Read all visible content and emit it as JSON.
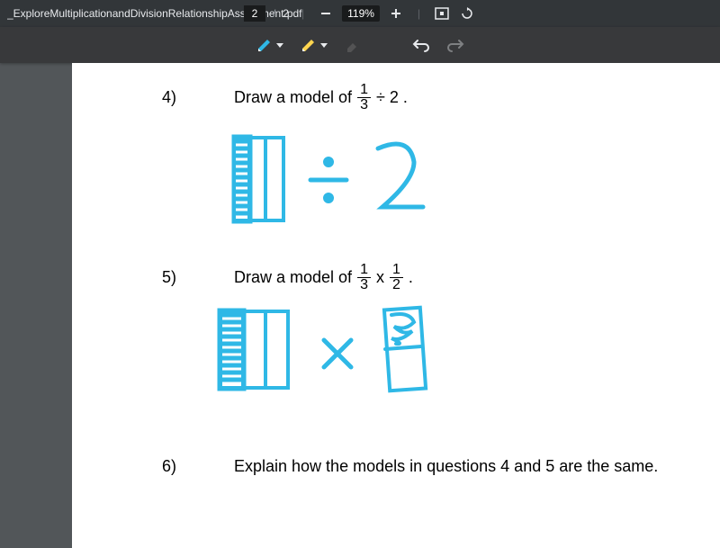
{
  "header": {
    "filename": "_ExploreMultiplicationandDivisionRelationshipAssignment.pdf",
    "current_page": "2",
    "page_separator": "/",
    "total_pages": "2",
    "zoom": "119%"
  },
  "problems": {
    "p4": {
      "number": "4)",
      "prompt_pre": "Draw a model of ",
      "frac_num": "1",
      "frac_den": "3",
      "prompt_post": "÷ 2 ."
    },
    "p5": {
      "number": "5)",
      "prompt_pre": "Draw a model of ",
      "fracA_num": "1",
      "fracA_den": "3",
      "mid": "x",
      "fracB_num": "1",
      "fracB_den": "2",
      "end": "."
    },
    "p6": {
      "number": "6)",
      "prompt": "Explain how the models in questions 4 and 5 are the same."
    }
  },
  "annotations": {
    "stroke_color": "#2fb8e6"
  }
}
